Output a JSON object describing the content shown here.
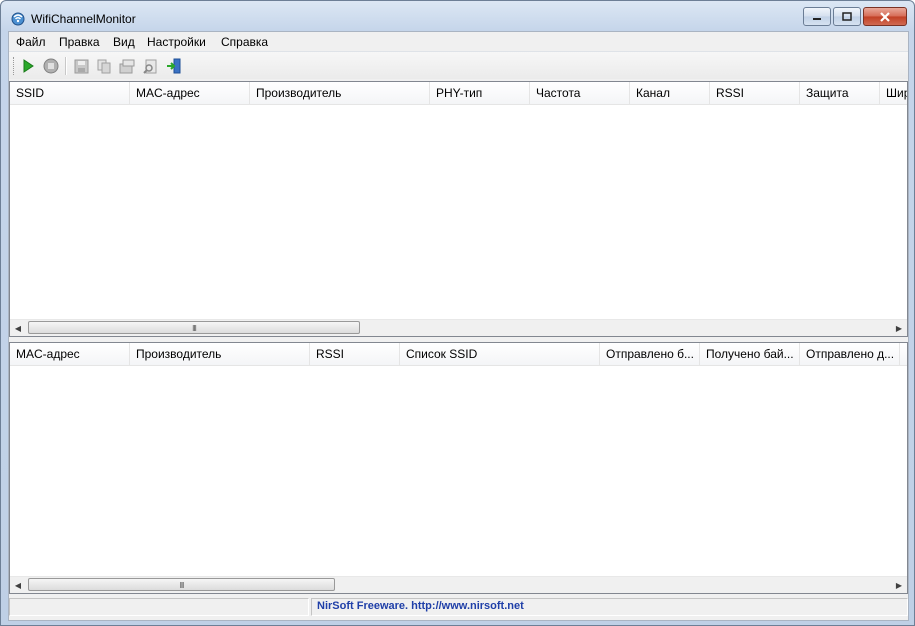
{
  "window": {
    "title": "WifiChannelMonitor"
  },
  "colors": {
    "link": "#1f3fa8",
    "play": "#2aa82a",
    "stop": "#8a8a8a"
  },
  "menu": [
    "Файл",
    "Правка",
    "Вид",
    "Настройки",
    "Справка"
  ],
  "toolbar": {
    "icons": [
      "play-icon",
      "stop-icon",
      "save-icon",
      "copy-icon",
      "properties-icon",
      "find-icon",
      "exit-icon"
    ]
  },
  "top_table": {
    "columns": [
      "SSID",
      "MAC-адрес",
      "Производитель",
      "PHY-тип",
      "Частота",
      "Канал",
      "RSSI",
      "Защита",
      "Шир"
    ],
    "rows": []
  },
  "bottom_table": {
    "columns": [
      "MAC-адрес",
      "Производитель",
      "RSSI",
      "Список SSID",
      "Отправлено б...",
      "Получено бай...",
      "Отправлено д..."
    ],
    "rows": []
  },
  "statusbar": {
    "link_text": "NirSoft Freeware.  http://www.nirsoft.net"
  },
  "scrollbar": {
    "grip": "III"
  }
}
